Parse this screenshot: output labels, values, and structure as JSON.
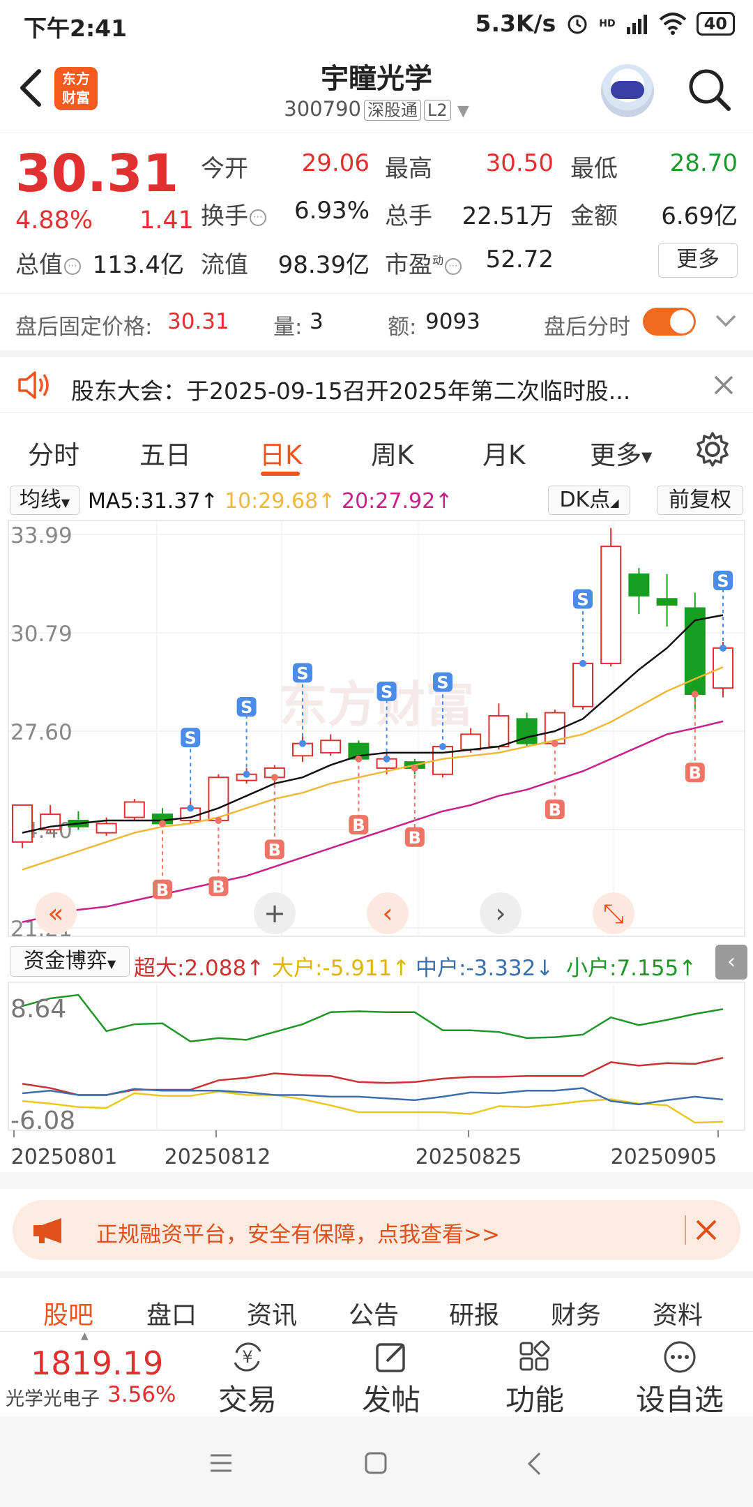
{
  "status": {
    "time": "下午2:41",
    "speed": "5.3K/s",
    "battery": "40",
    "hd": "HD"
  },
  "header": {
    "logo_line1": "东方",
    "logo_line2": "财富",
    "name": "宇瞳光学",
    "code": "300790",
    "tag1": "深股通",
    "tag2": "L2"
  },
  "quote": {
    "price": "30.31",
    "change_pct": "4.88%",
    "change_amt": "1.41",
    "open_label": "今开",
    "open": "29.06",
    "high_label": "最高",
    "high": "30.50",
    "low_label": "最低",
    "low": "28.70",
    "turnover_label": "换手",
    "turnover": "6.93%",
    "volume_label": "总手",
    "volume": "22.51万",
    "amount_label": "金额",
    "amount": "6.69亿",
    "mktcap_label": "总值",
    "mktcap": "113.4亿",
    "float_label": "流值",
    "float": "98.39亿",
    "pe_label": "市盈",
    "pe_sup": "动",
    "pe": "52.72",
    "more": "更多"
  },
  "afterhours": {
    "price_label": "盘后固定价格:",
    "price": "30.31",
    "vol_label": "量:",
    "vol": "3",
    "amt_label": "额:",
    "amt": "9093",
    "toggle_label": "盘后分时"
  },
  "notice": {
    "text": "股东大会：于2025-09-15召开2025年第二次临时股..."
  },
  "ktabs": [
    "分时",
    "五日",
    "日K",
    "周K",
    "月K",
    "更多"
  ],
  "mabar": {
    "selector": "均线",
    "ma5": "MA5:31.37",
    "ma10": "10:29.68",
    "ma20": "20:27.92",
    "dk": "DK点",
    "adjust": "前复权"
  },
  "colors": {
    "up": "#e0302f",
    "down": "#14a01e",
    "accent": "#f0541d",
    "ma5": "#111111",
    "ma10": "#f0b83a",
    "ma20": "#c8208a"
  },
  "chart_data": [
    {
      "type": "candlestick",
      "title": "",
      "y_ticks": [
        "33.99",
        "30.79",
        "27.60",
        "24.40",
        "21.21"
      ],
      "ylim": [
        21.21,
        33.99
      ],
      "candles": [
        {
          "o": 24.0,
          "h": 25.0,
          "c": 25.2,
          "l": 23.8
        },
        {
          "o": 24.4,
          "h": 25.2,
          "c": 24.9,
          "l": 24.3
        },
        {
          "o": 24.7,
          "h": 25.0,
          "c": 24.5,
          "l": 24.4
        },
        {
          "o": 24.3,
          "h": 24.8,
          "c": 24.6,
          "l": 24.2
        },
        {
          "o": 24.8,
          "h": 25.4,
          "c": 25.3,
          "l": 24.7
        },
        {
          "o": 24.9,
          "h": 25.1,
          "c": 24.6,
          "l": 24.5
        },
        {
          "o": 24.7,
          "h": 25.4,
          "c": 25.1,
          "l": 24.6
        },
        {
          "o": 24.7,
          "h": 26.2,
          "c": 26.1,
          "l": 24.6
        },
        {
          "o": 26.0,
          "h": 26.4,
          "c": 26.2,
          "l": 25.9
        },
        {
          "o": 26.1,
          "h": 26.5,
          "c": 26.4,
          "l": 25.8
        },
        {
          "o": 26.8,
          "h": 27.5,
          "c": 27.2,
          "l": 26.6
        },
        {
          "o": 26.9,
          "h": 27.5,
          "c": 27.3,
          "l": 26.8
        },
        {
          "o": 27.2,
          "h": 27.3,
          "c": 26.7,
          "l": 26.6
        },
        {
          "o": 26.4,
          "h": 26.9,
          "c": 26.7,
          "l": 26.2
        },
        {
          "o": 26.6,
          "h": 26.7,
          "c": 26.4,
          "l": 26.2
        },
        {
          "o": 26.2,
          "h": 27.2,
          "c": 27.1,
          "l": 26.1
        },
        {
          "o": 27.0,
          "h": 27.7,
          "c": 27.5,
          "l": 26.9
        },
        {
          "o": 27.1,
          "h": 28.5,
          "c": 28.1,
          "l": 27.0
        },
        {
          "o": 28.0,
          "h": 28.2,
          "c": 27.2,
          "l": 27.1
        },
        {
          "o": 27.2,
          "h": 28.3,
          "c": 28.2,
          "l": 27.1
        },
        {
          "o": 28.4,
          "h": 29.9,
          "c": 29.8,
          "l": 28.3
        },
        {
          "o": 29.8,
          "h": 34.2,
          "c": 33.6,
          "l": 29.7
        },
        {
          "o": 32.7,
          "h": 32.9,
          "c": 32.0,
          "l": 31.4
        },
        {
          "o": 31.9,
          "h": 32.7,
          "c": 31.7,
          "l": 31.0
        },
        {
          "o": 31.6,
          "h": 32.1,
          "c": 28.8,
          "l": 28.3
        },
        {
          "o": 29.0,
          "h": 30.5,
          "c": 30.3,
          "l": 28.7
        }
      ],
      "ma5": [
        24.3,
        24.5,
        24.6,
        24.7,
        24.7,
        24.7,
        24.8,
        25.1,
        25.5,
        25.9,
        26.1,
        26.5,
        26.8,
        26.9,
        26.9,
        26.9,
        27.0,
        27.1,
        27.4,
        27.6,
        28.0,
        28.8,
        29.6,
        30.3,
        31.2,
        31.37
      ],
      "ma10": [
        23.1,
        23.4,
        23.7,
        24.0,
        24.3,
        24.5,
        24.6,
        24.8,
        25.1,
        25.4,
        25.6,
        25.9,
        26.1,
        26.3,
        26.5,
        26.7,
        26.8,
        26.9,
        27.1,
        27.3,
        27.5,
        27.9,
        28.4,
        28.9,
        29.3,
        29.68
      ],
      "ma20": [
        21.4,
        21.6,
        21.8,
        21.9,
        22.1,
        22.3,
        22.5,
        22.7,
        22.9,
        23.2,
        23.5,
        23.8,
        24.1,
        24.4,
        24.7,
        25.0,
        25.2,
        25.5,
        25.7,
        26.0,
        26.3,
        26.7,
        27.1,
        27.5,
        27.7,
        27.92
      ],
      "signals": [
        {
          "i": 5,
          "t": "B"
        },
        {
          "i": 6,
          "t": "S"
        },
        {
          "i": 7,
          "t": "B"
        },
        {
          "i": 8,
          "t": "S"
        },
        {
          "i": 9,
          "t": "B"
        },
        {
          "i": 10,
          "t": "S"
        },
        {
          "i": 12,
          "t": "B"
        },
        {
          "i": 13,
          "t": "S"
        },
        {
          "i": 14,
          "t": "B"
        },
        {
          "i": 15,
          "t": "S"
        },
        {
          "i": 19,
          "t": "B"
        },
        {
          "i": 20,
          "t": "S"
        },
        {
          "i": 24,
          "t": "B"
        },
        {
          "i": 25,
          "t": "S"
        }
      ]
    },
    {
      "type": "line",
      "title": "资金博弈",
      "y_ticks": [
        "8.64",
        "-6.08"
      ],
      "ylim": [
        -6.08,
        8.64
      ],
      "x_ticks": [
        "20250801",
        "20250812",
        "20250825",
        "20250905"
      ],
      "series": [
        {
          "name": "超大",
          "color": "#c83232",
          "values": [
            -1.5,
            -2.0,
            -2.8,
            -2.8,
            -2.2,
            -2.2,
            -2.2,
            -1.1,
            -0.8,
            -0.3,
            -0.5,
            -0.6,
            -1.3,
            -1.4,
            -1.3,
            -0.9,
            -0.7,
            -0.7,
            -0.6,
            -0.6,
            -0.6,
            1.0,
            0.6,
            0.9,
            0.8,
            1.5
          ]
        },
        {
          "name": "大户",
          "color": "#e8c81e",
          "values": [
            -3.5,
            -3.8,
            -4.2,
            -4.3,
            -2.6,
            -2.9,
            -2.9,
            -2.4,
            -2.8,
            -2.8,
            -3.3,
            -4.0,
            -4.8,
            -4.8,
            -4.8,
            -4.8,
            -5.0,
            -4.1,
            -4.2,
            -3.9,
            -3.5,
            -3.3,
            -3.8,
            -4.0,
            -6.0,
            -5.911
          ]
        },
        {
          "name": "中户",
          "color": "#3c6eaa",
          "values": [
            -2.6,
            -2.3,
            -2.8,
            -2.8,
            -2.1,
            -2.3,
            -2.3,
            -2.3,
            -2.5,
            -2.8,
            -2.8,
            -3.0,
            -3.0,
            -3.2,
            -3.4,
            -3.0,
            -2.5,
            -2.6,
            -2.3,
            -2.3,
            -2.0,
            -3.5,
            -3.9,
            -3.4,
            -3.0,
            -3.332
          ]
        },
        {
          "name": "小户",
          "color": "#1e9628",
          "values": [
            7.5,
            8.4,
            8.8,
            4.6,
            5.4,
            5.5,
            3.4,
            3.8,
            3.6,
            4.5,
            5.4,
            6.8,
            6.9,
            6.8,
            6.8,
            4.7,
            4.7,
            4.5,
            3.8,
            3.9,
            4.2,
            6.2,
            5.3,
            5.9,
            6.6,
            7.155
          ]
        }
      ],
      "legend_values": {
        "超大": "2.088",
        "大户": "-5.911",
        "中户": "-3.332",
        "小户": "7.155"
      }
    }
  ],
  "flowbar": {
    "selector": "资金博弈",
    "super": "超大:2.088",
    "big": "大户:-5.911",
    "mid": "中户:-3.332",
    "small": "小户:7.155"
  },
  "ad": {
    "text": "正规融资平台，安全有保障，点我查看>>"
  },
  "btabs": [
    "股吧",
    "盘口",
    "资讯",
    "公告",
    "研报",
    "财务",
    "资料"
  ],
  "bottombar": {
    "index_value": "1819.19",
    "index_name": "光学光电子",
    "index_pct": "3.56%",
    "trade": "交易",
    "post": "发帖",
    "function": "功能",
    "watch": "设自选"
  }
}
